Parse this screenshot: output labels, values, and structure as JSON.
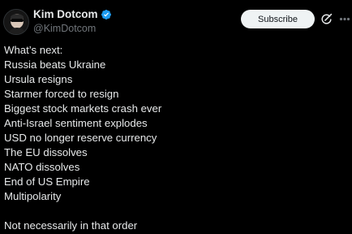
{
  "author": {
    "display_name": "Kim Dotcom",
    "handle": "@KimDotcom",
    "verified_icon": "verified-badge-icon",
    "verified_color": "#1d9bf0"
  },
  "actions": {
    "subscribe_label": "Subscribe",
    "grok_icon": "grok-icon",
    "more_icon": "more-options-icon"
  },
  "post": {
    "lines": [
      "What’s next:",
      "Russia beats Ukraine",
      "Ursula resigns",
      "Starmer forced to resign",
      "Biggest stock markets crash ever",
      "Anti-Israel sentiment explodes",
      "USD no longer reserve currency",
      "The EU dissolves",
      "NATO dissolves",
      "End of US Empire",
      "Multipolarity"
    ],
    "closing": "Not necessarily in that order"
  },
  "colors": {
    "background": "#000000",
    "text": "#e7e9ea",
    "muted": "#71767b",
    "button_bg": "#eff3f4"
  }
}
